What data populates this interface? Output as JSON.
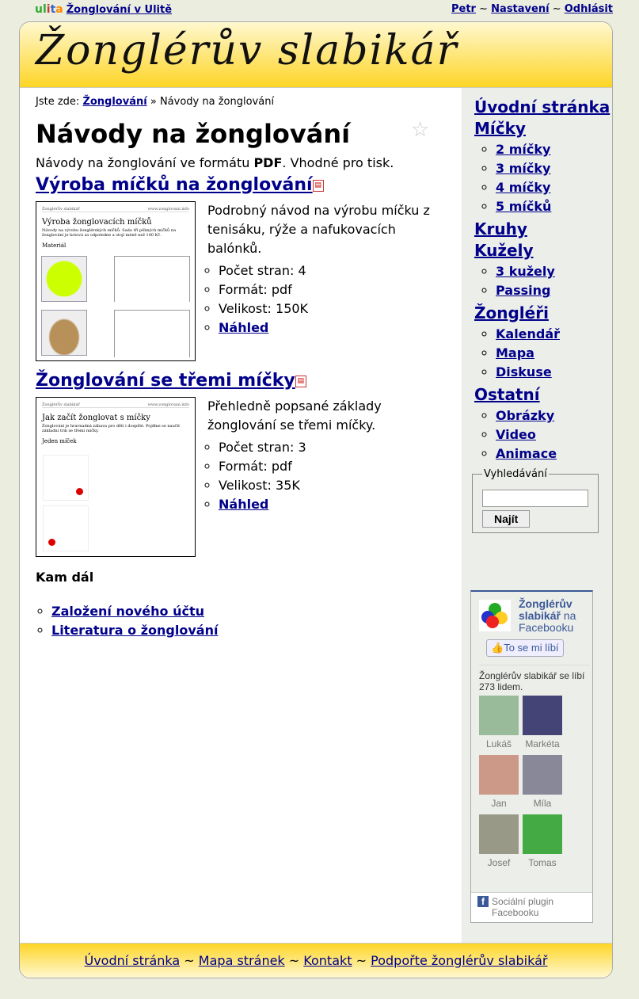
{
  "topbar": {
    "logo": "ulita",
    "site_link": "Žonglování v Ulitě",
    "user": "Petr",
    "settings": "Nastavení",
    "logout": "Odhlásit",
    "sep": "~"
  },
  "header": {
    "title": "Žonglérův slabikář"
  },
  "breadcrumb": {
    "prefix": "Jste zde:",
    "link": "Žonglování",
    "sep": "»",
    "current": "Návody na žonglování"
  },
  "page_title": "Návody na žonglování",
  "intro": {
    "before": "Návody na žonglování ve formátu ",
    "bold": "PDF",
    "after": ". Vhodné pro tisk."
  },
  "items": [
    {
      "title": "Výroba míčků na žonglování",
      "description": "Podrobný návod na výrobu míčku z tenisáku, rýže a nafukovacích balónků.",
      "pages": "Počet stran: 4",
      "format": "Formát: pdf",
      "size": "Velikost: 150K",
      "preview": "Náhled",
      "thumb": {
        "header_left": "Žonglérův slabikář",
        "header_right": "www.zonglovani.info",
        "title": "Výroba žonglovacích míčků",
        "text": "Návody na výrobu žonglérských míčků. Sada tří pěkných míčků na žonglování je hotová za odpoledne a stojí méně než 100 Kč.",
        "section": "Materiál"
      }
    },
    {
      "title": "Žonglování se třemi míčky",
      "description": "Přehledně popsané základy žonglování se třemi míčky.",
      "pages": "Počet stran: 3",
      "format": "Formát: pdf",
      "size": "Velikost: 35K",
      "preview": "Náhled",
      "thumb": {
        "header_left": "Žonglérův slabikář",
        "header_right": "www.zonglovani.info",
        "title": "Jak začít žonglovat s míčky",
        "text": "Žonglování je hravnadná zábava pro děti i dospělé. Pojďme se naučit základní trik se třemi míčky.",
        "section": "Jeden míček"
      }
    }
  ],
  "next": {
    "heading": "Kam dál",
    "links": [
      "Založení nového účtu",
      "Literatura o žonglování"
    ]
  },
  "nav": {
    "home": "Úvodní stránka",
    "balls": "Míčky",
    "balls_items": [
      "2 míčky",
      "3 míčky",
      "4 míčky",
      "5 míčků"
    ],
    "rings": "Kruhy",
    "clubs": "Kužely",
    "clubs_items": [
      "3 kužely",
      "Passing"
    ],
    "jugglers": "Žongléři",
    "jugglers_items": [
      "Kalendář",
      "Mapa",
      "Diskuse"
    ],
    "other": "Ostatní",
    "other_items": [
      "Obrázky",
      "Video",
      "Animace"
    ]
  },
  "search": {
    "legend": "Vyhledávání",
    "value": "",
    "button": "Najít"
  },
  "facebook": {
    "page_name": "Žonglérův slabikář",
    "na": "na",
    "fb": "Facebooku",
    "like": "To se mi líbí",
    "count_text": "Žonglérův slabikář se líbí 273 lidem.",
    "faces": [
      "Lukáš",
      "Markéta",
      "Jan",
      "Míla",
      "Josef",
      "Tomas"
    ],
    "social": "Sociální plugin Facebooku"
  },
  "footer": {
    "links": [
      "Úvodní stránka",
      "Mapa stránek",
      "Kontakt",
      "Podpořte žonglérův slabikář"
    ],
    "sep": "~"
  }
}
